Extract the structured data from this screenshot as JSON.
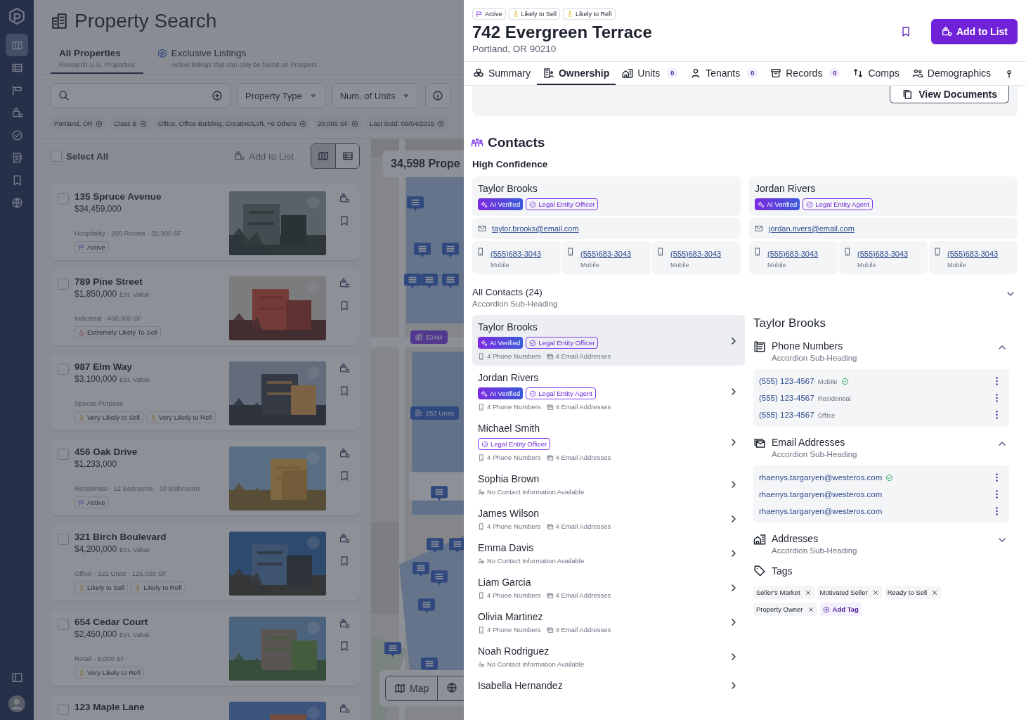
{
  "nav": [
    {
      "selected": true
    },
    {
      "selected": false
    },
    {
      "selected": false
    },
    {
      "selected": false
    },
    {
      "selected": false
    },
    {
      "selected": false
    },
    {
      "selected": false
    },
    {
      "selected": false
    }
  ],
  "page": {
    "title": "Property Search",
    "tabs": [
      {
        "label": "All Properties",
        "sub": "Research U.S. Properties",
        "selected": true
      },
      {
        "label": "Exclusive Listings",
        "sub": "Active listings that can only be found on Prospect",
        "selected": false
      }
    ],
    "filters": {
      "property_type": "Property Type",
      "units": "Num. of Units"
    },
    "chips": [
      "Portland, OR",
      "Class B",
      "Office, Office Building, Creative/Loft, +6 Others",
      "20,000 SF",
      "Last Sold: 09/04/2015"
    ],
    "select_all": {
      "label": "Select All",
      "checked": false
    },
    "add_to_list": "Add to List",
    "view_toggle": [
      {
        "selected": true
      },
      {
        "selected": false
      }
    ],
    "properties": [
      {
        "name": "135 Spruce Avenue",
        "price": "$34,459,000",
        "details": "Hospitality · 200 Rooms · 32,000 SF",
        "checked": false,
        "tags": [
          {
            "kind": "active",
            "label": "Active"
          }
        ]
      },
      {
        "name": "789 Pine Street",
        "price": "$1,850,000",
        "price_note": "Est. Value",
        "details": "Industrial · 450,000 SF",
        "checked": false,
        "tags": [
          {
            "kind": "hot",
            "label": "Extremely Likely To Sell"
          }
        ]
      },
      {
        "name": "987 Elm Way",
        "price": "$3,100,000",
        "price_note": "Est. Value",
        "details": "Special Purpose",
        "checked": false,
        "tags": [
          {
            "kind": "likely",
            "label": "Very Likely to Sell"
          },
          {
            "kind": "likely",
            "label": "Very Likely to Refi"
          }
        ]
      },
      {
        "name": "456 Oak Drive",
        "price": "$1,233,000",
        "details": "Residential · 12 Bedrooms · 10 Bathrooms",
        "checked": false,
        "tags": [
          {
            "kind": "active",
            "label": "Active"
          }
        ]
      },
      {
        "name": "321 Birch Boulevard",
        "price": "$4,200,000",
        "price_note": "Est. Value",
        "details": "Office · 322 Units · 125,000 SF",
        "checked": false,
        "tags": [
          {
            "kind": "likely",
            "label": "Likely to Sell"
          },
          {
            "kind": "likely",
            "label": "Likely to Refi"
          }
        ]
      },
      {
        "name": "654 Cedar Court",
        "price": "$2,450,000",
        "price_note": "Est. Value",
        "details": "Retail · 9,000 SF",
        "checked": false,
        "tags": [
          {
            "kind": "likely",
            "label": "Very Likely to Refi"
          }
        ]
      },
      {
        "name": "123 Maple Lane",
        "checked": false
      }
    ],
    "map": {
      "count": "34,598 Prope",
      "markers": [
        {
          "kind": "price",
          "label": "$34M"
        },
        {
          "kind": "units",
          "label": "252 Units"
        }
      ],
      "map_button": "Map"
    }
  },
  "detail": {
    "tags": [
      {
        "kind": "active",
        "label": "Active"
      },
      {
        "kind": "likely",
        "label": "Likely to Sell"
      },
      {
        "kind": "likely",
        "label": "Likely to Refi"
      }
    ],
    "title": "742 Evergreen Terrace",
    "address": "Portland, OR 90210",
    "add_button": "Add to List",
    "tabs": [
      {
        "label": "Summary",
        "selected": false
      },
      {
        "label": "Ownership",
        "selected": true
      },
      {
        "label": "Units",
        "count": "0",
        "selected": false
      },
      {
        "label": "Tenants",
        "count": "0",
        "selected": false
      },
      {
        "label": "Records",
        "count": "0",
        "selected": false
      },
      {
        "label": "Comps",
        "selected": false
      },
      {
        "label": "Demographics",
        "selected": false
      }
    ],
    "view_documents": "View Documents"
  },
  "contacts": {
    "title": "Contacts",
    "group": "High Confidence",
    "top": [
      {
        "name": "Taylor Brooks",
        "badges": [
          {
            "kind": "ai",
            "label": "AI Verified"
          },
          {
            "kind": "role",
            "label": "Legal Entity Officer"
          }
        ],
        "email": "taylor.brooks@email.com",
        "phones": [
          {
            "number": "(555)683-3043",
            "type": "Mobile"
          },
          {
            "number": "(555)683-3043",
            "type": "Mobile"
          },
          {
            "number": "(555)683-3043",
            "type": "Mobile"
          }
        ]
      },
      {
        "name": "Jordan Rivers",
        "badges": [
          {
            "kind": "ai",
            "label": "AI Verified"
          },
          {
            "kind": "role",
            "label": "Legal Entity Agent"
          }
        ],
        "email": "jordan.rivers@email.com",
        "phones": [
          {
            "number": "(555)683-3043",
            "type": "Mobile"
          },
          {
            "number": "(555)683-3043",
            "type": "Mobile"
          },
          {
            "number": "(555)683-3043",
            "type": "Mobile"
          }
        ]
      }
    ],
    "all": {
      "title": "All Contacts (24)",
      "sub": "Accordion Sub-Heading",
      "list": [
        {
          "name": "Taylor Brooks",
          "selected": true,
          "badges": [
            {
              "kind": "ai",
              "label": "AI Verified"
            },
            {
              "kind": "role",
              "label": "Legal Entity Officer"
            }
          ],
          "phones": "4 Phone Numbers",
          "emails": "4 Email Addresses"
        },
        {
          "name": "Jordan Rivers",
          "selected": false,
          "badges": [
            {
              "kind": "ai",
              "label": "AI Verified"
            },
            {
              "kind": "role",
              "label": "Legal Entity Agent"
            }
          ],
          "phones": "4 Phone Numbers",
          "emails": "4 Email Addresses"
        },
        {
          "name": "Michael Smith",
          "selected": false,
          "badges": [
            {
              "kind": "role",
              "label": "Legal Entity Officer"
            }
          ],
          "phones": "4 Phone Numbers",
          "emails": "4 Email Addresses"
        },
        {
          "name": "Sophia Brown",
          "selected": false,
          "no_info": "No Contact Information Available"
        },
        {
          "name": "James Wilson",
          "selected": false,
          "phones": "4 Phone Numbers",
          "emails": "4 Email Addresses"
        },
        {
          "name": "Emma Davis",
          "selected": false,
          "no_info": "No Contact Information Available"
        },
        {
          "name": "Liam Garcia",
          "selected": false,
          "phones": "4 Phone Numbers",
          "emails": "4 Email Addresses"
        },
        {
          "name": "Olivia Martinez",
          "selected": false,
          "phones": "4 Phone Numbers",
          "emails": "4 Email Addresses"
        },
        {
          "name": "Noah Rodriguez",
          "selected": false,
          "no_info": "No Contact Information Available"
        },
        {
          "name": "Isabella Hernandez",
          "selected": false
        }
      ]
    },
    "detail": {
      "name": "Taylor Brooks",
      "sections": [
        {
          "kind": "phones",
          "title": "Phone Numbers",
          "sub": "Accordion Sub-Heading",
          "expanded": true,
          "items": [
            {
              "value": "(555) 123-4567",
              "type": "Mobile",
              "verified": true
            },
            {
              "value": "(555) 123-4567",
              "type": "Residential",
              "verified": false
            },
            {
              "value": "(555) 123-4567",
              "type": "Office",
              "verified": false
            }
          ]
        },
        {
          "kind": "emails",
          "title": "Email Addresses",
          "sub": "Accordion Sub-Heading",
          "expanded": true,
          "items": [
            {
              "value": "rhaenys.targaryen@westeros.com",
              "verified": true
            },
            {
              "value": "rhaenys.targaryen@westeros.com",
              "verified": false
            },
            {
              "value": "rhaenys.targaryen@westeros.com",
              "verified": false
            }
          ]
        },
        {
          "kind": "addresses",
          "title": "Addresses",
          "sub": "Accordion Sub-Heading",
          "expanded": false
        }
      ],
      "tags_title": "Tags",
      "tags": [
        "Seller's Market",
        "Motivated Seller",
        "Ready to Sell",
        "Property Owner"
      ],
      "add_tag": "Add Tag"
    }
  }
}
